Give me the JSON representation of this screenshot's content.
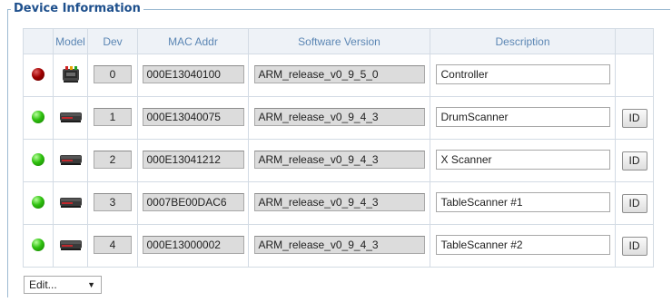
{
  "section": {
    "title": "Device Information"
  },
  "table": {
    "headers": [
      "",
      "Model",
      "Dev",
      "MAC Addr",
      "Software Version",
      "Description",
      ""
    ],
    "rows": [
      {
        "status": "red",
        "model_icon": "controller-icon",
        "dev": "0",
        "mac": "000E13040100",
        "software": "ARM_release_v0_9_5_0",
        "description": "Controller",
        "has_id": false
      },
      {
        "status": "green",
        "model_icon": "scanner-icon",
        "dev": "1",
        "mac": "000E13040075",
        "software": "ARM_release_v0_9_4_3",
        "description": "DrumScanner",
        "has_id": true
      },
      {
        "status": "green",
        "model_icon": "scanner-icon",
        "dev": "2",
        "mac": "000E13041212",
        "software": "ARM_release_v0_9_4_3",
        "description": "X Scanner",
        "has_id": true
      },
      {
        "status": "green",
        "model_icon": "scanner-icon",
        "dev": "3",
        "mac": "0007BE00DAC6",
        "software": "ARM_release_v0_9_4_3",
        "description": "TableScanner #1",
        "has_id": true
      },
      {
        "status": "green",
        "model_icon": "scanner-icon",
        "dev": "4",
        "mac": "000E13000002",
        "software": "ARM_release_v0_9_4_3",
        "description": "TableScanner #2",
        "has_id": true
      }
    ],
    "id_label": "ID"
  },
  "edit_select": {
    "value": "Edit..."
  },
  "colors": {
    "led_red": "#a00000",
    "led_green": "#2fc10f",
    "header_text": "#5b86b4",
    "title": "#1d4f8c"
  }
}
